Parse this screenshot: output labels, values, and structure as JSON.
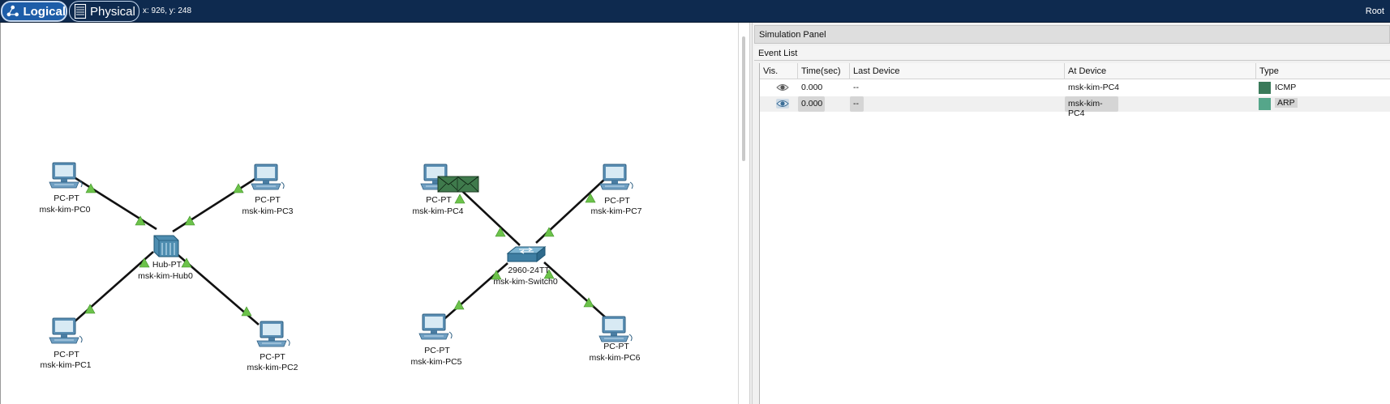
{
  "topbar": {
    "logical_label": "Logical",
    "physical_label": "Physical",
    "coords": "x: 926, y: 248",
    "root_label": "Root"
  },
  "colors": {
    "topbar_bg": "#0e2a4f",
    "link": "#111111",
    "link_status": "#6cc24a",
    "pdu": "#3f7a4c",
    "icmp": "#3a7a5a",
    "arp": "#55a68a"
  },
  "devices": {
    "pc0": {
      "type": "PC-PT",
      "name": "msk-kim-PC0",
      "icon": "pc-icon"
    },
    "pc1": {
      "type": "PC-PT",
      "name": "msk-kim-PC1",
      "icon": "pc-icon"
    },
    "pc2": {
      "type": "PC-PT",
      "name": "msk-kim-PC2",
      "icon": "pc-icon"
    },
    "pc3": {
      "type": "PC-PT",
      "name": "msk-kim-PC3",
      "icon": "pc-icon"
    },
    "hub0": {
      "type": "Hub-PT",
      "name": "msk-kim-Hub0",
      "icon": "hub-icon"
    },
    "pc4": {
      "type": "PC-PT",
      "name": "msk-kim-PC4",
      "icon": "pc-icon"
    },
    "pc5": {
      "type": "PC-PT",
      "name": "msk-kim-PC5",
      "icon": "pc-icon"
    },
    "pc6": {
      "type": "PC-PT",
      "name": "msk-kim-PC6",
      "icon": "pc-icon"
    },
    "pc7": {
      "type": "PC-PT",
      "name": "msk-kim-PC7",
      "icon": "pc-icon"
    },
    "switch0": {
      "type": "2960-24TT",
      "name": "msk-kim-Switch0",
      "icon": "switch-icon"
    }
  },
  "simulation": {
    "panel_title": "Simulation Panel",
    "event_list_title": "Event List",
    "columns": [
      "Vis.",
      "Time(sec)",
      "Last Device",
      "At Device",
      "Type"
    ],
    "events": [
      {
        "vis_icon": "eye-icon",
        "time": "0.000",
        "last_device": "--",
        "at_device": "msk-kim-PC4",
        "type": "ICMP",
        "selected": false
      },
      {
        "vis_icon": "eye-icon",
        "time": "0.000",
        "last_device": "--",
        "at_device": "msk-kim-PC4",
        "type": "ARP",
        "selected": true
      }
    ]
  }
}
